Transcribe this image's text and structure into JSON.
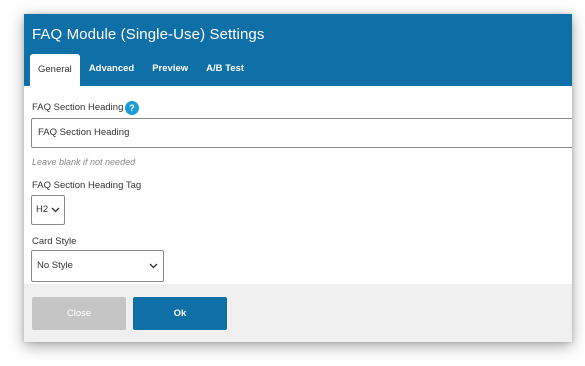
{
  "dialog": {
    "title": "FAQ Module (Single-Use) Settings",
    "tabs": [
      {
        "label": "General",
        "active": true
      },
      {
        "label": "Advanced",
        "active": false
      },
      {
        "label": "Preview",
        "active": false
      },
      {
        "label": "A/B Test",
        "active": false
      }
    ]
  },
  "form": {
    "heading_label": "FAQ Section Heading",
    "help_icon_glyph": "?",
    "heading_value": "FAQ Section Heading",
    "heading_hint": "Leave blank if not needed",
    "tag_label": "FAQ Section Heading Tag",
    "tag_value": "H2",
    "card_style_label": "Card Style",
    "card_style_value": "No Style"
  },
  "footer": {
    "close_label": "Close",
    "ok_label": "Ok"
  },
  "colors": {
    "header_bg": "#0f6fa7",
    "help_icon": "#1e9bd6",
    "ok_button": "#0f6fa7",
    "close_button": "#c5c5c5",
    "footer_bg": "#f0f0f0"
  }
}
